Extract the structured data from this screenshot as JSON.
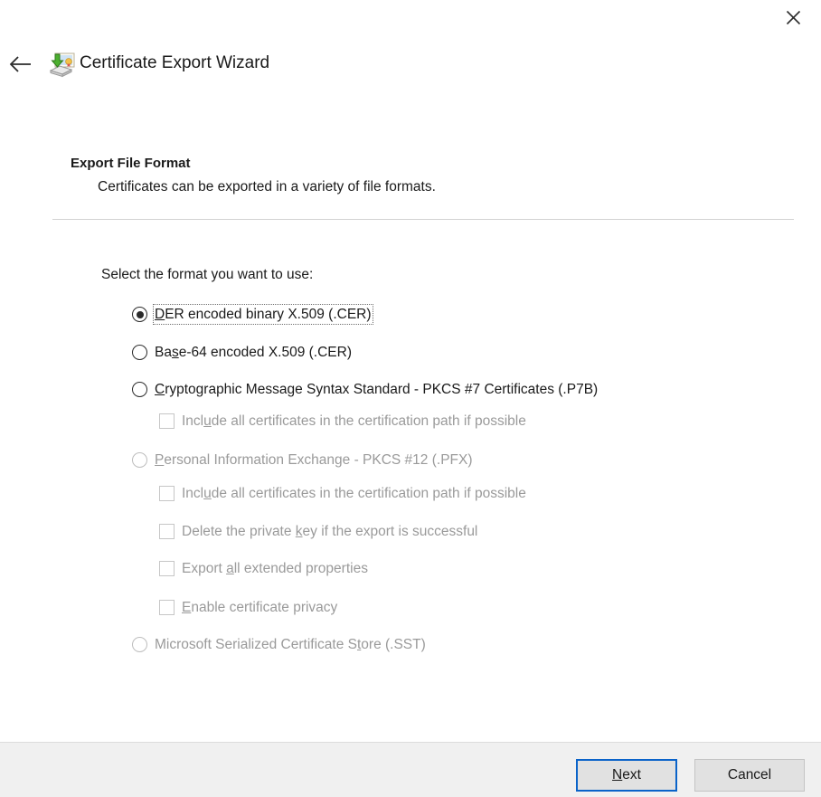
{
  "window": {
    "title": "Certificate Export Wizard",
    "close_label": "✕",
    "back_label": "←",
    "icon_name": "certificate-export-icon"
  },
  "header": {
    "title": "Export File Format",
    "subtitle": "Certificates can be exported in a variety of file formats."
  },
  "main": {
    "prompt": "Select the format you want to use:",
    "options": [
      {
        "type": "radio",
        "label": "DER encoded binary X.509 (.CER)",
        "accel": "D",
        "label_rest": "ER encoded binary X.509 (.CER)",
        "selected": true,
        "disabled": false,
        "focused": true,
        "indent": 0
      },
      {
        "type": "radio",
        "label": "Base-64 encoded X.509 (.CER)",
        "accel": "s",
        "label_pre": "Ba",
        "label_rest": "e-64 encoded X.509 (.CER)",
        "selected": false,
        "disabled": false,
        "focused": false,
        "indent": 0
      },
      {
        "type": "radio",
        "label": "Cryptographic Message Syntax Standard - PKCS #7 Certificates (.P7B)",
        "accel": "C",
        "label_rest": "ryptographic Message Syntax Standard - PKCS #7 Certificates (.P7B)",
        "selected": false,
        "disabled": false,
        "focused": false,
        "indent": 0
      },
      {
        "type": "checkbox",
        "label": "Include all certificates in the certification path if possible",
        "accel": "u",
        "label_pre": "Incl",
        "label_rest": "de all certificates in the certification path if possible",
        "checked": false,
        "disabled": true,
        "indent": 1
      },
      {
        "type": "radio",
        "label": "Personal Information Exchange - PKCS #12 (.PFX)",
        "accel": "P",
        "label_rest": "ersonal Information Exchange - PKCS #12 (.PFX)",
        "selected": false,
        "disabled": true,
        "focused": false,
        "indent": 0
      },
      {
        "type": "checkbox",
        "label": "Include all certificates in the certification path if possible",
        "accel": "u",
        "label_pre": "Incl",
        "label_rest": "de all certificates in the certification path if possible",
        "checked": false,
        "disabled": true,
        "indent": 1
      },
      {
        "type": "checkbox",
        "label": "Delete the private key if the export is successful",
        "accel": "k",
        "label_pre": "Delete the private ",
        "label_rest": "ey if the export is successful",
        "checked": false,
        "disabled": true,
        "indent": 1
      },
      {
        "type": "checkbox",
        "label": "Export all extended properties",
        "accel": "a",
        "label_pre": "Export ",
        "label_rest": "ll extended properties",
        "checked": false,
        "disabled": true,
        "indent": 1
      },
      {
        "type": "checkbox",
        "label": "Enable certificate privacy",
        "accel": "E",
        "label_pre": "",
        "label_rest": "nable certificate privacy",
        "checked": false,
        "disabled": true,
        "indent": 1
      },
      {
        "type": "radio",
        "label": "Microsoft Serialized Certificate Store (.SST)",
        "accel": "t",
        "label_pre": "Microsoft Serialized Certificate S",
        "label_rest": "ore (.SST)",
        "selected": false,
        "disabled": true,
        "focused": false,
        "indent": 0
      }
    ]
  },
  "footer": {
    "next_label": "Next",
    "next_accel": "N",
    "next_rest": "ext",
    "cancel_label": "Cancel",
    "accent_color": "#0a63c9"
  }
}
